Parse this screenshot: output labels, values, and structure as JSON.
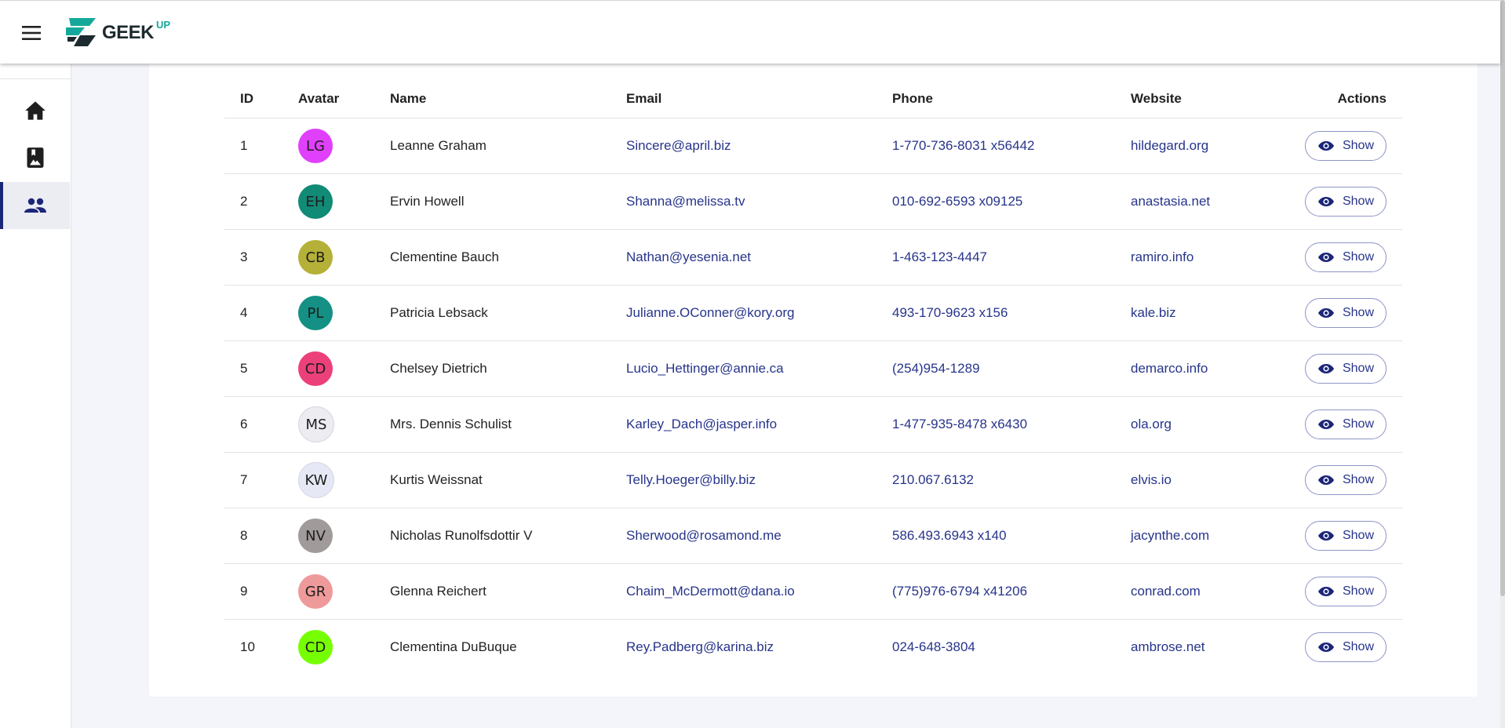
{
  "header": {
    "menu_icon": "hamburger-menu-icon",
    "logo_text": "GEEK",
    "logo_sup": "UP",
    "brand_color": "#14a89a"
  },
  "sidebar": {
    "items": [
      {
        "icon": "home-icon",
        "active": false
      },
      {
        "icon": "photo-album-icon",
        "active": false
      },
      {
        "icon": "people-icon",
        "active": true
      }
    ]
  },
  "table": {
    "headers": [
      "ID",
      "Avatar",
      "Name",
      "Email",
      "Phone",
      "Website",
      "Actions"
    ],
    "action_label": "Show",
    "action_icon": "eye-icon",
    "link_color": "#27348b",
    "rows": [
      {
        "id": "1",
        "initials": "LG",
        "avatar_color": "#e040fb",
        "name": "Leanne Graham",
        "email": "Sincere@april.biz",
        "phone": "1-770-736-8031 x56442",
        "website": "hildegard.org"
      },
      {
        "id": "2",
        "initials": "EH",
        "avatar_color": "#118a76",
        "name": "Ervin Howell",
        "email": "Shanna@melissa.tv",
        "phone": "010-692-6593 x09125",
        "website": "anastasia.net"
      },
      {
        "id": "3",
        "initials": "CB",
        "avatar_color": "#b5b038",
        "name": "Clementine Bauch",
        "email": "Nathan@yesenia.net",
        "phone": "1-463-123-4447",
        "website": "ramiro.info"
      },
      {
        "id": "4",
        "initials": "PL",
        "avatar_color": "#149084",
        "name": "Patricia Lebsack",
        "email": "Julianne.OConner@kory.org",
        "phone": "493-170-9623 x156",
        "website": "kale.biz"
      },
      {
        "id": "5",
        "initials": "CD",
        "avatar_color": "#ec407a",
        "name": "Chelsey Dietrich",
        "email": "Lucio_Hettinger@annie.ca",
        "phone": "(254)954-1289",
        "website": "demarco.info"
      },
      {
        "id": "6",
        "initials": "MS",
        "avatar_color": "#ececf1",
        "name": "Mrs. Dennis Schulist",
        "email": "Karley_Dach@jasper.info",
        "phone": "1-477-935-8478 x6430",
        "website": "ola.org"
      },
      {
        "id": "7",
        "initials": "KW",
        "avatar_color": "#e6e8f5",
        "name": "Kurtis Weissnat",
        "email": "Telly.Hoeger@billy.biz",
        "phone": "210.067.6132",
        "website": "elvis.io"
      },
      {
        "id": "8",
        "initials": "NV",
        "avatar_color": "#a19a9a",
        "name": "Nicholas Runolfsdottir V",
        "email": "Sherwood@rosamond.me",
        "phone": "586.493.6943 x140",
        "website": "jacynthe.com"
      },
      {
        "id": "9",
        "initials": "GR",
        "avatar_color": "#ef9a9a",
        "name": "Glenna Reichert",
        "email": "Chaim_McDermott@dana.io",
        "phone": "(775)976-6794 x41206",
        "website": "conrad.com"
      },
      {
        "id": "10",
        "initials": "CD",
        "avatar_color": "#76ff03",
        "name": "Clementina DuBuque",
        "email": "Rey.Padberg@karina.biz",
        "phone": "024-648-3804",
        "website": "ambrose.net"
      }
    ]
  }
}
